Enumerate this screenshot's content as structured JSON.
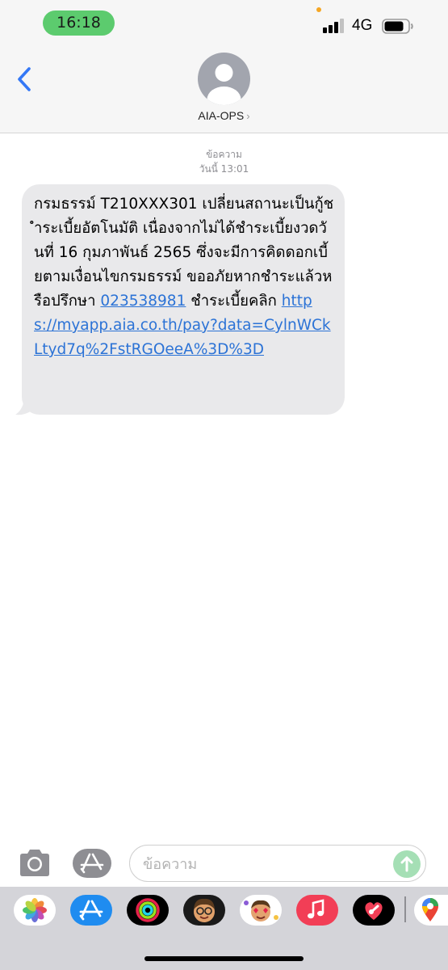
{
  "status_bar": {
    "time": "16:18",
    "network": "4G",
    "signal_bars_active": 3,
    "signal_bars_total": 4,
    "battery_level": 0.75
  },
  "header": {
    "contact_name": "AIA-OPS",
    "contact_chevron": "›",
    "back_icon": "chevron-left-icon",
    "avatar_icon": "person-icon"
  },
  "conversation": {
    "service_label": "ข้อความ",
    "timestamp": "วันนี้ 13:01",
    "message": {
      "text_part1": "กรมธรรม์ T210XXX301 เปลี่ยนสถานะเป็นกู้ชำระเบี้ยอัตโนมัติ เนื่องจากไม่ได้ชำระเบี้ยงวดวันที่ 16 กุมภาพันธ์ 2565 ซึ่งจะมีการคิดดอกเบี้ยตามเงื่อนไขกรมธรรม์ ขออภัยหากชำระแล้วหรือปรึกษา ",
      "phone_link": "023538981",
      "text_part2": " ชำระเบี้ยคลิก ",
      "url_link": "https://myapp.aia.co.th/pay?data=CylnWCkLtyd7q%2FstRGOeeA%3D%3D"
    }
  },
  "composer": {
    "placeholder": "ข้อความ",
    "camera_icon": "camera-icon",
    "apps_icon": "app-store-icon",
    "send_icon": "send-arrow-icon"
  },
  "app_drawer": {
    "apps": [
      "photos-icon",
      "app-store-icon",
      "activity-icon",
      "memoji-icon",
      "memoji-stickers-icon",
      "music-icon",
      "digital-touch-icon",
      "maps-icon"
    ]
  },
  "colors": {
    "time_pill": "#5ccb6e",
    "link": "#2c73d6",
    "bubble": "#e9e9eb",
    "accent_blue": "#3478f6"
  }
}
